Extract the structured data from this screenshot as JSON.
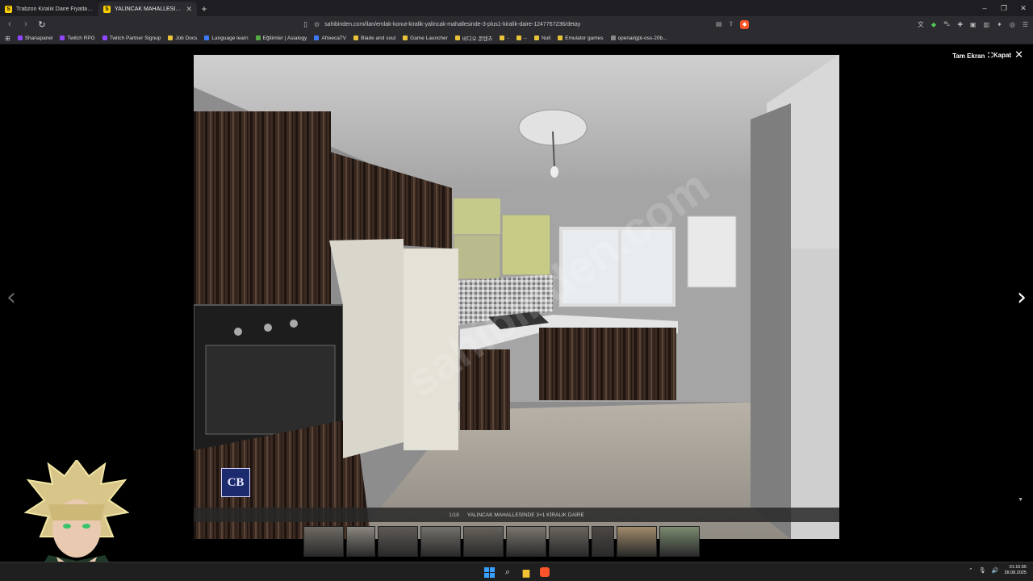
{
  "browser": {
    "tabs": [
      {
        "title": "Trabzon Kiralık Daire Fiyatları ve Kira",
        "favicon": "sahibinden-favicon",
        "active": false
      },
      {
        "title": "YALINCAK MAHALLESİNDE 3+1",
        "favicon": "sahibinden-favicon",
        "active": true
      }
    ],
    "url": "sahibinden.com/ilan/emlak-konut-kiralik-yalincak-mahallesinde-3-plus1-kiralik-daire-1247767236/detay",
    "bookmarks": [
      {
        "label": "Shanapanel",
        "icon": "purple"
      },
      {
        "label": "Twitch RPG",
        "icon": "purple"
      },
      {
        "label": "Twitch Partner Signup",
        "icon": "purple"
      },
      {
        "label": "Job Docs",
        "icon": "folder"
      },
      {
        "label": "Language learn",
        "icon": "blue"
      },
      {
        "label": "Eğitimler | Asialogy",
        "icon": "green"
      },
      {
        "label": "AfreecaTV",
        "icon": "blue"
      },
      {
        "label": "Blade and soul",
        "icon": "folder"
      },
      {
        "label": "Game Launcher",
        "icon": "folder"
      },
      {
        "label": "비디오 콘텐츠",
        "icon": "folder"
      },
      {
        "label": "-",
        "icon": "folder"
      },
      {
        "label": "--",
        "icon": "folder"
      },
      {
        "label": "Null",
        "icon": "folder"
      },
      {
        "label": "Emulator games",
        "icon": "folder"
      },
      {
        "label": "openai/gpt-oss-20b...",
        "icon": "grey"
      }
    ]
  },
  "gallery": {
    "fullscreen_label": "Tam Ekran",
    "close_label": "Kapat",
    "counter": "1/18",
    "caption": "YALINCAK MAHALLESİNDE 3+1 KİRALIK DAİRE",
    "watermark": "sahibinden.com",
    "logo_text": "CB",
    "thumbnails": 10
  },
  "taskbar": {
    "time": "01:15:55",
    "date": "28.08.2025"
  },
  "colors": {
    "accent": "#ffd200",
    "brave": "#fb542b",
    "windows_blue": "#3aa0ff"
  }
}
